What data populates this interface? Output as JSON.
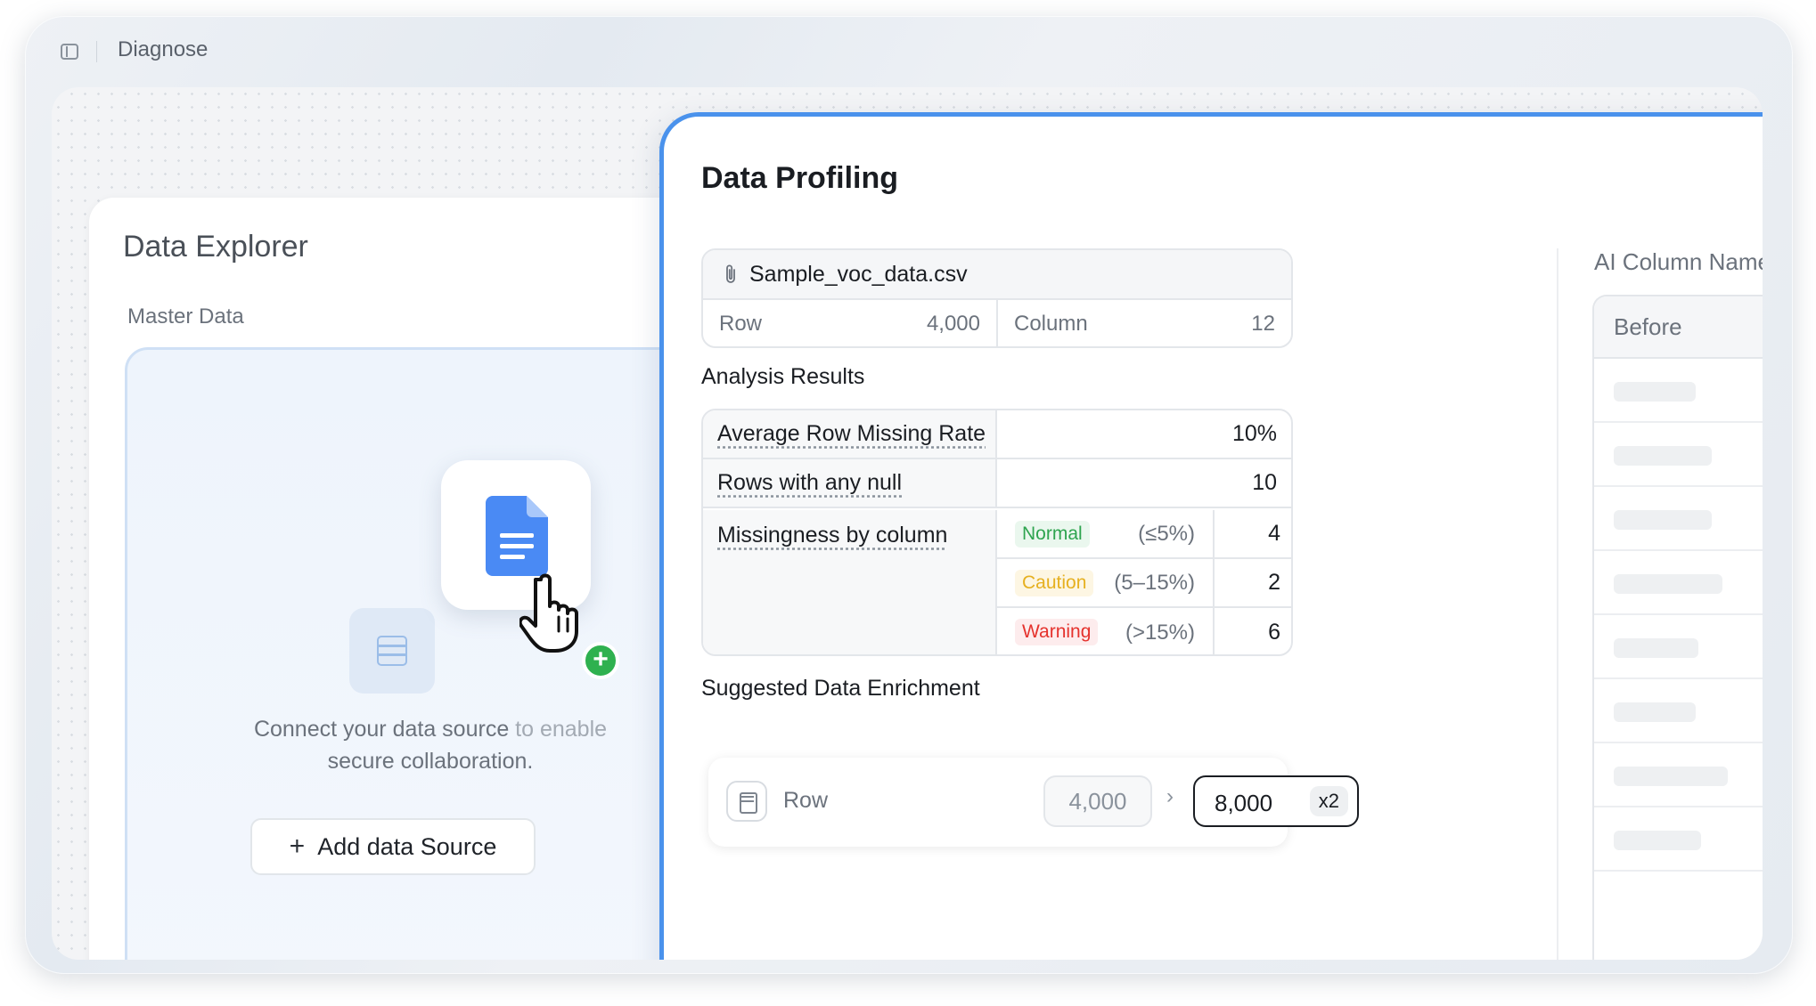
{
  "window": {
    "title": "Diagnose"
  },
  "explorer": {
    "title": "Data Explorer",
    "section_label": "Master Data",
    "connect_text_main": "Connect your data source ",
    "connect_text_faded": "to enable",
    "connect_text_line2": "secure collaboration.",
    "add_button_label": "Add data Source",
    "add_button_icon": "plus-icon",
    "upload_icon": "document-icon",
    "cursor_icon": "hand-pointer-icon",
    "accent_colors": {
      "doc_blue": "#4a8af4",
      "add_green": "#2fb14f"
    }
  },
  "profiling": {
    "title": "Data Profiling",
    "file": {
      "name": "Sample_voc_data.csv",
      "icon": "paperclip-icon",
      "row_label": "Row",
      "row_value": "4,000",
      "column_label": "Column",
      "column_value": "12"
    },
    "analysis": {
      "title": "Analysis Results",
      "avg_missing_label": "Average Row Missing Rate",
      "avg_missing_value": "10%",
      "rows_null_label": "Rows with any null",
      "rows_null_value": "10",
      "missingness_label": "Missingness by column",
      "levels": [
        {
          "tag": "Normal",
          "range": "(≤5%)",
          "count": "4",
          "color": "#2ea44f"
        },
        {
          "tag": "Caution",
          "range": "(5–15%)",
          "count": "2",
          "color": "#e6b020"
        },
        {
          "tag": "Warning",
          "range": "(>15%)",
          "count": "6",
          "color": "#e5322d"
        }
      ]
    },
    "enrichment": {
      "title": "Suggested Data Enrichment",
      "row_label": "Row",
      "old_value": "4,000",
      "new_value": "8,000",
      "multiplier": "x2",
      "arrow": "›"
    },
    "ai_panel": {
      "title": "AI Column Name Upd",
      "before_header": "Before"
    },
    "accent_color": "#4a92ec"
  }
}
